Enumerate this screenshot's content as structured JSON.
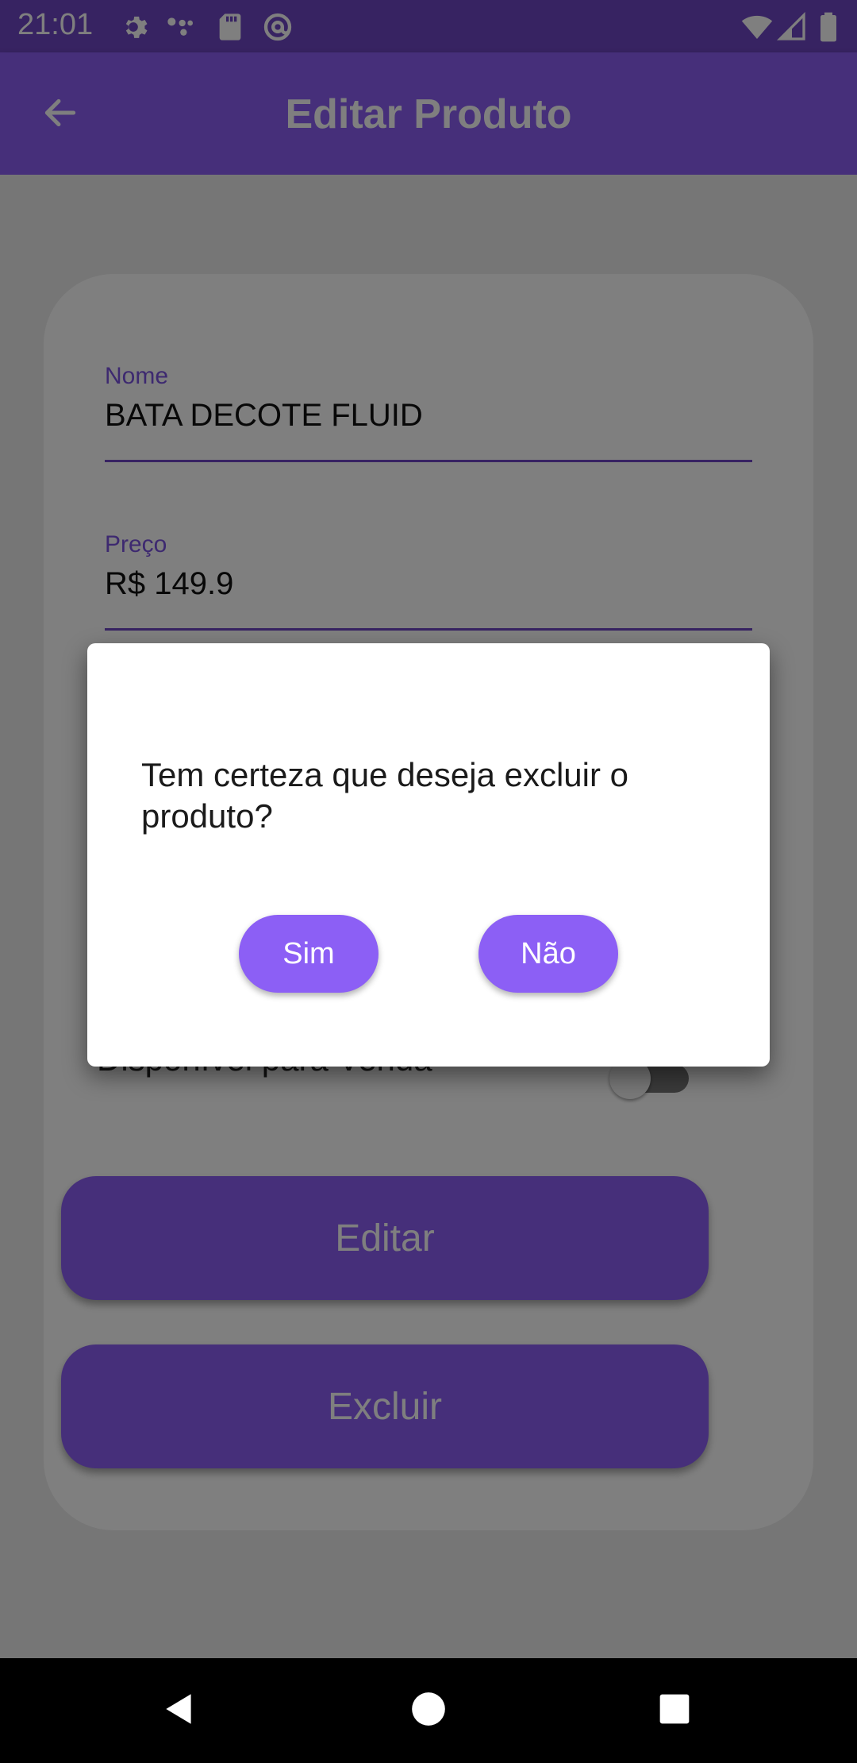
{
  "status_bar": {
    "time": "21:01",
    "left_icons": [
      "gear-icon",
      "dots-icon",
      "sd-card-icon",
      "at-sign-icon"
    ],
    "right_icons": [
      "wifi-icon",
      "signal-icon",
      "battery-icon"
    ]
  },
  "app_bar": {
    "title": "Editar Produto",
    "back_icon": "arrow-left-icon"
  },
  "form": {
    "name_label": "Nome",
    "name_value": "BATA DECOTE FLUID",
    "price_label": "Preço",
    "price_value": "R$ 149.9",
    "available_label": "Disponível para Venda",
    "available_on": false,
    "edit_label": "Editar",
    "delete_label": "Excluir"
  },
  "dialog": {
    "message": "Tem certeza que deseja excluir o produto?",
    "yes_label": "Sim",
    "no_label": "Não"
  },
  "nav": [
    "back-triangle-icon",
    "home-circle-icon",
    "recents-square-icon"
  ],
  "colors": {
    "primary": "#8c5ff5",
    "status_bar": "#6f46c4",
    "scrim": "rgba(0,0,0,0.5)"
  }
}
